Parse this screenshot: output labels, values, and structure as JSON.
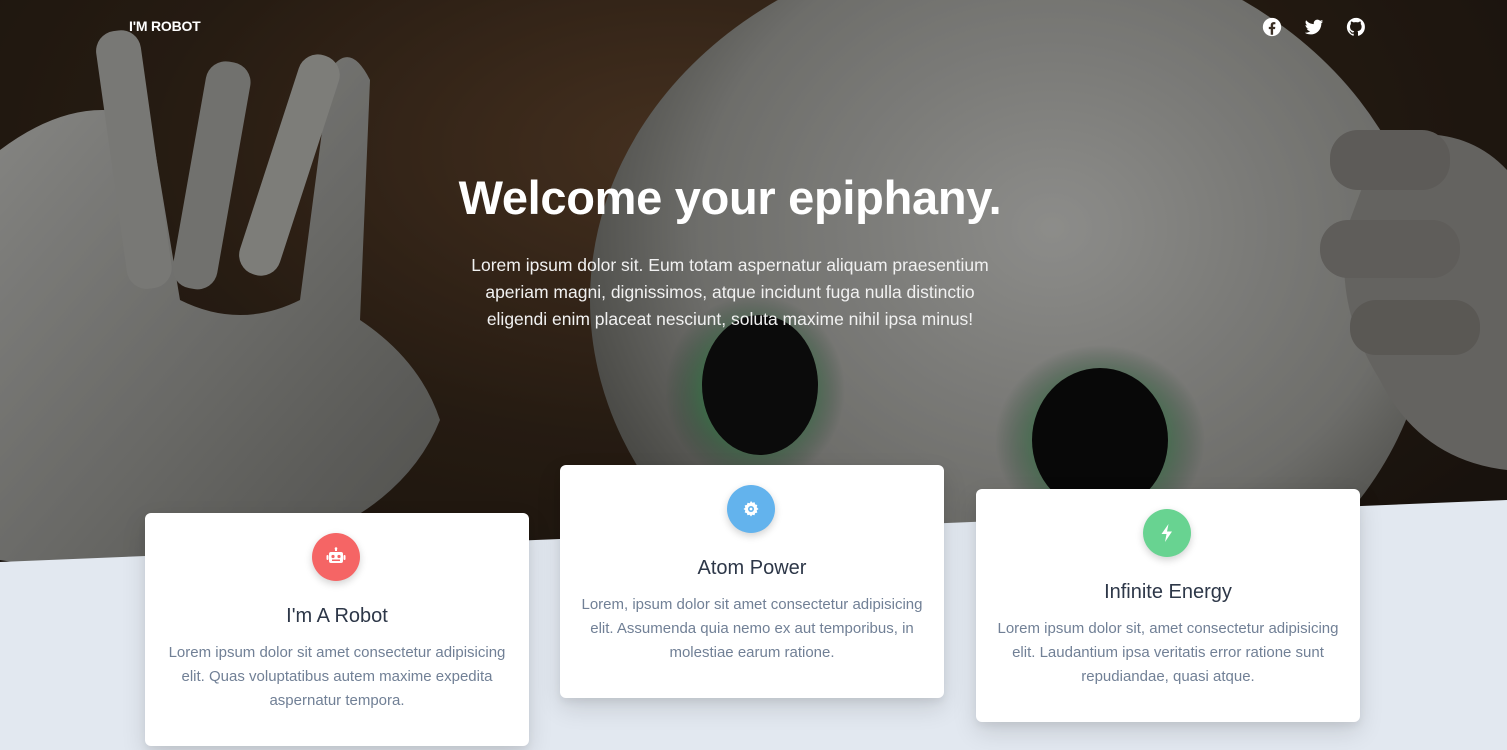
{
  "nav": {
    "brand": "I'M ROBOT",
    "social": [
      {
        "icon": "facebook-icon"
      },
      {
        "icon": "twitter-icon"
      },
      {
        "icon": "github-icon"
      }
    ]
  },
  "hero": {
    "title": "Welcome your epiphany.",
    "text": "Lorem ipsum dolor sit. Eum totam aspernatur aliquam praesentium aperiam magni, dignissimos, atque incidunt fuga nulla distinctio eligendi enim placeat nesciunt, soluta maxime nihil ipsa minus!"
  },
  "features": [
    {
      "icon": "robot-icon",
      "color": "#f56565",
      "title": "I'm A Robot",
      "text": "Lorem ipsum dolor sit amet consectetur adipisicing elit. Quas voluptatibus autem maxime expedita aspernatur tempora."
    },
    {
      "icon": "cog-icon",
      "color": "#63b3ed",
      "title": "Atom Power",
      "text": "Lorem, ipsum dolor sit amet consectetur adipisicing elit. Assumenda quia nemo ex aut temporibus, in molestiae earum ratione."
    },
    {
      "icon": "bolt-icon",
      "color": "#68d391",
      "title": "Infinite Energy",
      "text": "Lorem ipsum dolor sit, amet consectetur adipisicing elit. Laudantium ipsa veritatis error ratione sunt repudiandae, quasi atque."
    }
  ],
  "colors": {
    "section_background": "#e2e8f0",
    "card_background": "#ffffff",
    "heading_text": "#2d3748",
    "body_text": "#718096"
  }
}
